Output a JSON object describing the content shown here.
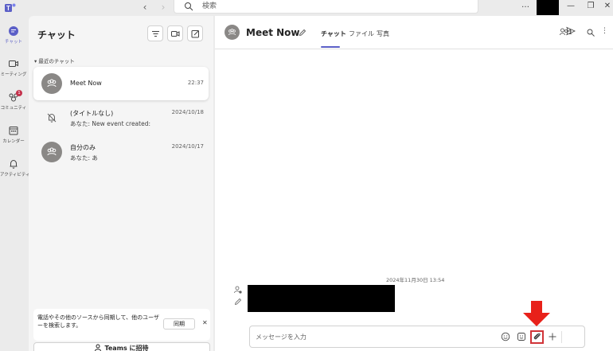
{
  "titlebar": {
    "search_placeholder": "検索",
    "more": "…"
  },
  "rail": {
    "items": [
      {
        "label": "チャット",
        "icon": "chat-icon",
        "active": true
      },
      {
        "label": "ミーティング",
        "icon": "video-icon"
      },
      {
        "label": "コミュニティ",
        "icon": "community-icon",
        "badge": "1"
      },
      {
        "label": "カレンダー",
        "icon": "calendar-icon"
      },
      {
        "label": "アクティビティ",
        "icon": "bell-icon"
      }
    ]
  },
  "panel": {
    "title": "チャット",
    "section": "▾ 最近のチャット",
    "chats": [
      {
        "name": "Meet Now",
        "date": "22:37",
        "preview": ""
      },
      {
        "name": "(タイトルなし)",
        "date": "2024/10/18",
        "preview": "あなた: New event created:"
      },
      {
        "name": "自分のみ",
        "date": "2024/10/17",
        "preview": "あなた: あ"
      }
    ],
    "notice": {
      "text": "電話やその他のソースから同期して、他のユーザーを検索します。",
      "sync_button": "同期",
      "close": "✕"
    },
    "invite_button": "Teams に招待"
  },
  "main": {
    "title": "Meet Now",
    "tabs": [
      "チャット",
      "ファイル",
      "写真"
    ],
    "participants": "1",
    "more": "⋮",
    "timestamp": "2024年11月30日 13:54",
    "compose_placeholder": "メッセージを入力"
  },
  "colors": {
    "accent": "#5b5fc7",
    "highlight": "#d13438",
    "badge": "#c4314b"
  }
}
